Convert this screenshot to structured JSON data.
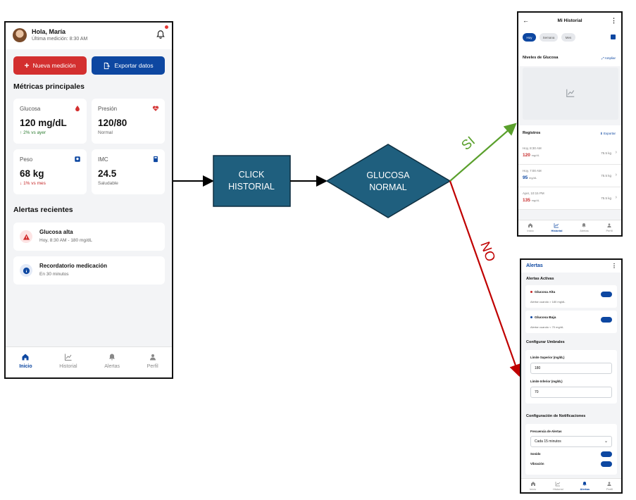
{
  "main_screen": {
    "greeting": "Hola, María",
    "last_measurement": "Última medición: 8:30 AM",
    "new_measurement_button": "Nueva medición",
    "export_button": "Exportar datos",
    "metrics_title": "Métricas principales",
    "metrics": [
      {
        "label": "Glucosa",
        "value": "120 mg/dL",
        "note": "2% vs ayer",
        "icon": "drop-icon"
      },
      {
        "label": "Presión",
        "value": "120/80",
        "note": "Normal",
        "icon": "heart-pulse-icon"
      },
      {
        "label": "Peso",
        "value": "68 kg",
        "note": "1% vs mes",
        "icon": "scale-icon"
      },
      {
        "label": "IMC",
        "value": "24.5",
        "note": "Saludable",
        "icon": "calculator-icon"
      }
    ],
    "alerts_title": "Alertas recientes",
    "alerts": [
      {
        "title": "Glucosa alta",
        "subtitle": "Hoy, 8:30 AM - 180 mg/dL",
        "icon": "warning-icon"
      },
      {
        "title": "Recordatorio medicación",
        "subtitle": "En 30 minutos",
        "icon": "info-icon"
      }
    ],
    "nav": [
      "Inicio",
      "Historial",
      "Alertas",
      "Perfil"
    ]
  },
  "flow": {
    "process_label_line1": "CLICK",
    "process_label_line2": "HISTORIAL",
    "decision_label_line1": "GLUCOSA",
    "decision_label_line2": "NORMAL",
    "yes_label": "SI",
    "no_label": "NO"
  },
  "history_screen": {
    "title": "Mi Historial",
    "tabs": [
      "Hoy",
      "Semana",
      "Mes"
    ],
    "glucose_levels_title": "Niveles de Glucosa",
    "expand_link": "Ampliar",
    "records_title": "Registros",
    "export_link": "Exportar",
    "records": [
      {
        "time": "Hoy, 8:30 AM",
        "value": "120",
        "unit": "mg/dL",
        "weight": "75.5 kg",
        "color": "#c62828"
      },
      {
        "time": "Hoy, 7:00 AM",
        "value": "95",
        "unit": "mg/dL",
        "weight": "75.5 kg",
        "color": "#0d47a1"
      },
      {
        "time": "Ayer, 10:15 PM",
        "value": "135",
        "unit": "mg/dL",
        "weight": "75.5 kg",
        "color": "#c62828"
      }
    ],
    "nav": [
      "Inicio",
      "Historial",
      "Alertas",
      "Perfil"
    ]
  },
  "alerts_screen": {
    "title": "Alertas",
    "active_title": "Alertas Activas",
    "active_alerts": [
      {
        "name": "Glucosa Alta",
        "desc": "Alertar cuando > 180 mg/dL",
        "color": "#c62828"
      },
      {
        "name": "Glucosa Baja",
        "desc": "Alertar cuando < 70 mg/dL",
        "color": "#0d47a1"
      }
    ],
    "thresholds_title": "Configurar Umbrales",
    "upper_label": "Límite Superior (mg/dL)",
    "upper_value": "180",
    "lower_label": "Límite Inferior (mg/dL)",
    "lower_value": "70",
    "notif_title": "Configuración de Notificaciones",
    "frequency_label": "Frecuencia de Alertas",
    "frequency_value": "Cada 15 minutos",
    "sound_label": "Sonido",
    "vibration_label": "Vibración",
    "nav": [
      "Inicio",
      "Historial",
      "Alertas",
      "Perfil"
    ]
  },
  "colors": {
    "flow_box": "#1f5f7e",
    "yes_arrow": "#5aa02c",
    "no_arrow": "#c00000",
    "primary": "#0d47a1",
    "danger": "#d32f2f"
  }
}
